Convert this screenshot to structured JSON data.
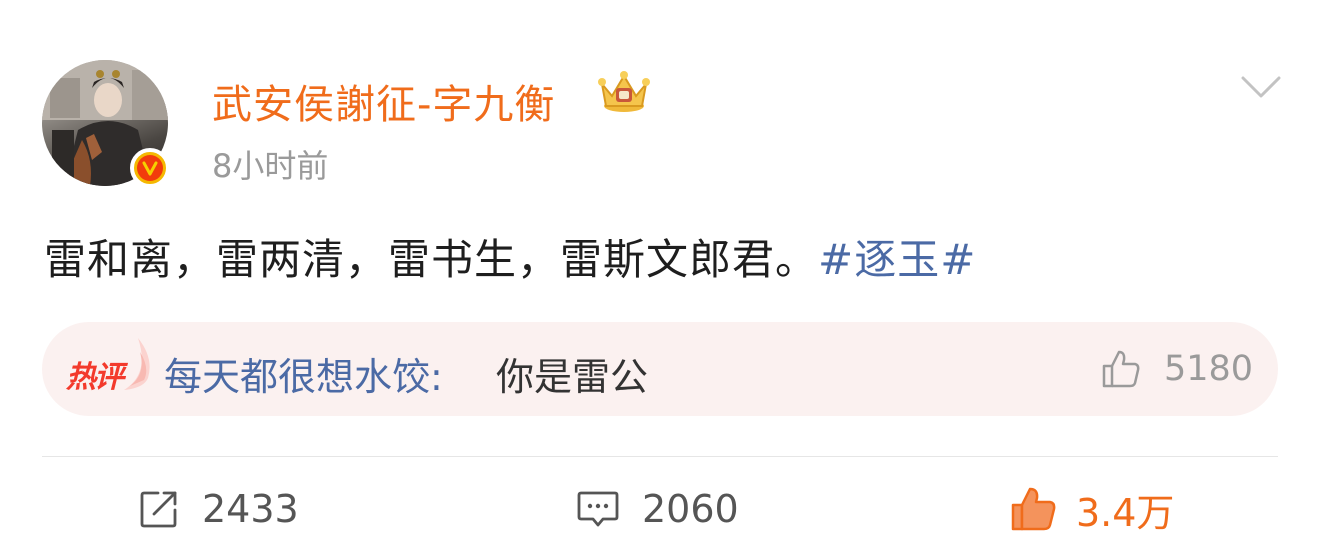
{
  "header": {
    "username": "武安侯謝征-字九衡",
    "timestamp": "8小时前",
    "verified_icon": "v-verified-icon",
    "crown_icon": "crown-icon",
    "menu_icon": "chevron-down-icon"
  },
  "post": {
    "text": "雷和离，雷两清，雷书生，雷斯文郎君。",
    "hashtag": "#逐玉#"
  },
  "hot_comment": {
    "label": "热评",
    "user": "每天都很想水饺",
    "separator": ": ",
    "text": "你是雷公",
    "likes": "5180"
  },
  "actions": {
    "repost_count": "2433",
    "comment_count": "2060",
    "like_count": "3.4万"
  },
  "colors": {
    "username": "#f06c1b",
    "hashtag": "#4b6aa5",
    "hot_label": "#f33a2c",
    "hot_bg": "#fbf1f0",
    "liked": "#f06c1b"
  }
}
